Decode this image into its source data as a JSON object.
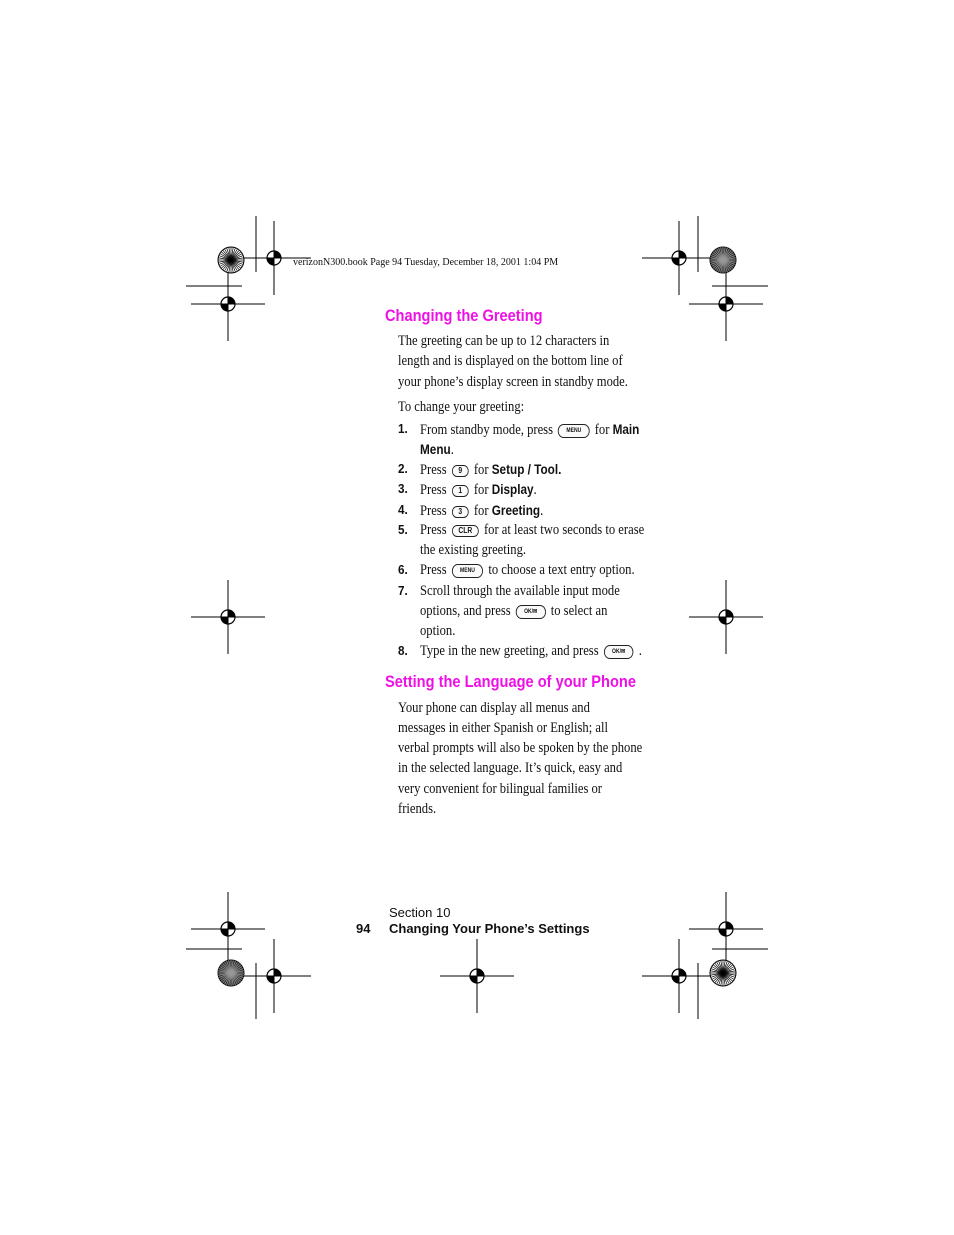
{
  "header": "verizonN300.book  Page 94  Tuesday, December 18, 2001  1:04 PM",
  "section1": {
    "title": "Changing the Greeting",
    "intro": [
      "The greeting can be up to 12 characters in",
      "length and is displayed on the bottom line of",
      "your phone’s display screen in standby mode."
    ],
    "lead": "To change your greeting:",
    "steps": [
      {
        "n": "1.",
        "a": "From standby mode, press",
        "key": "MENU",
        "b": "for",
        "bold": "Main",
        "line2_bold": "Menu",
        "line2": "."
      },
      {
        "n": "2.",
        "a": "Press",
        "key": "9",
        "b": "for",
        "bold": "Setup / Tool."
      },
      {
        "n": "3.",
        "a": "Press",
        "key": "1",
        "b": "for",
        "bold": "Display",
        "c": "."
      },
      {
        "n": "4.",
        "a": "Press",
        "key": "3",
        "b": "for",
        "bold": "Greeting",
        "c": "."
      },
      {
        "n": "5.",
        "a": "Press",
        "key": "CLR",
        "b": "for at least two seconds to erase",
        "line2": "the existing greeting."
      },
      {
        "n": "6.",
        "a": "Press",
        "key": "MENU",
        "b": "to choose a text entry option."
      },
      {
        "n": "7.",
        "a": "Scroll through the available input mode",
        "line2a": "options, and press",
        "key": "OK/✉",
        "line2b": "to select an",
        "line3": "option."
      },
      {
        "n": "8.",
        "a": "Type in the new greeting, and press",
        "key": "OK/✉",
        "c": "."
      }
    ]
  },
  "section2": {
    "title": "Setting the Language of your Phone",
    "body": [
      "Your phone can display all menus and",
      "messages in either Spanish or English; all",
      "verbal prompts will also be spoken by the phone",
      "in the selected language. It’s quick, easy and",
      "very convenient for bilingual families or",
      "friends."
    ]
  },
  "footer": {
    "section": "Section 10",
    "page": "94",
    "chapter": "Changing Your Phone’s Settings"
  },
  "colors": {
    "heading": "#ee10e6"
  }
}
